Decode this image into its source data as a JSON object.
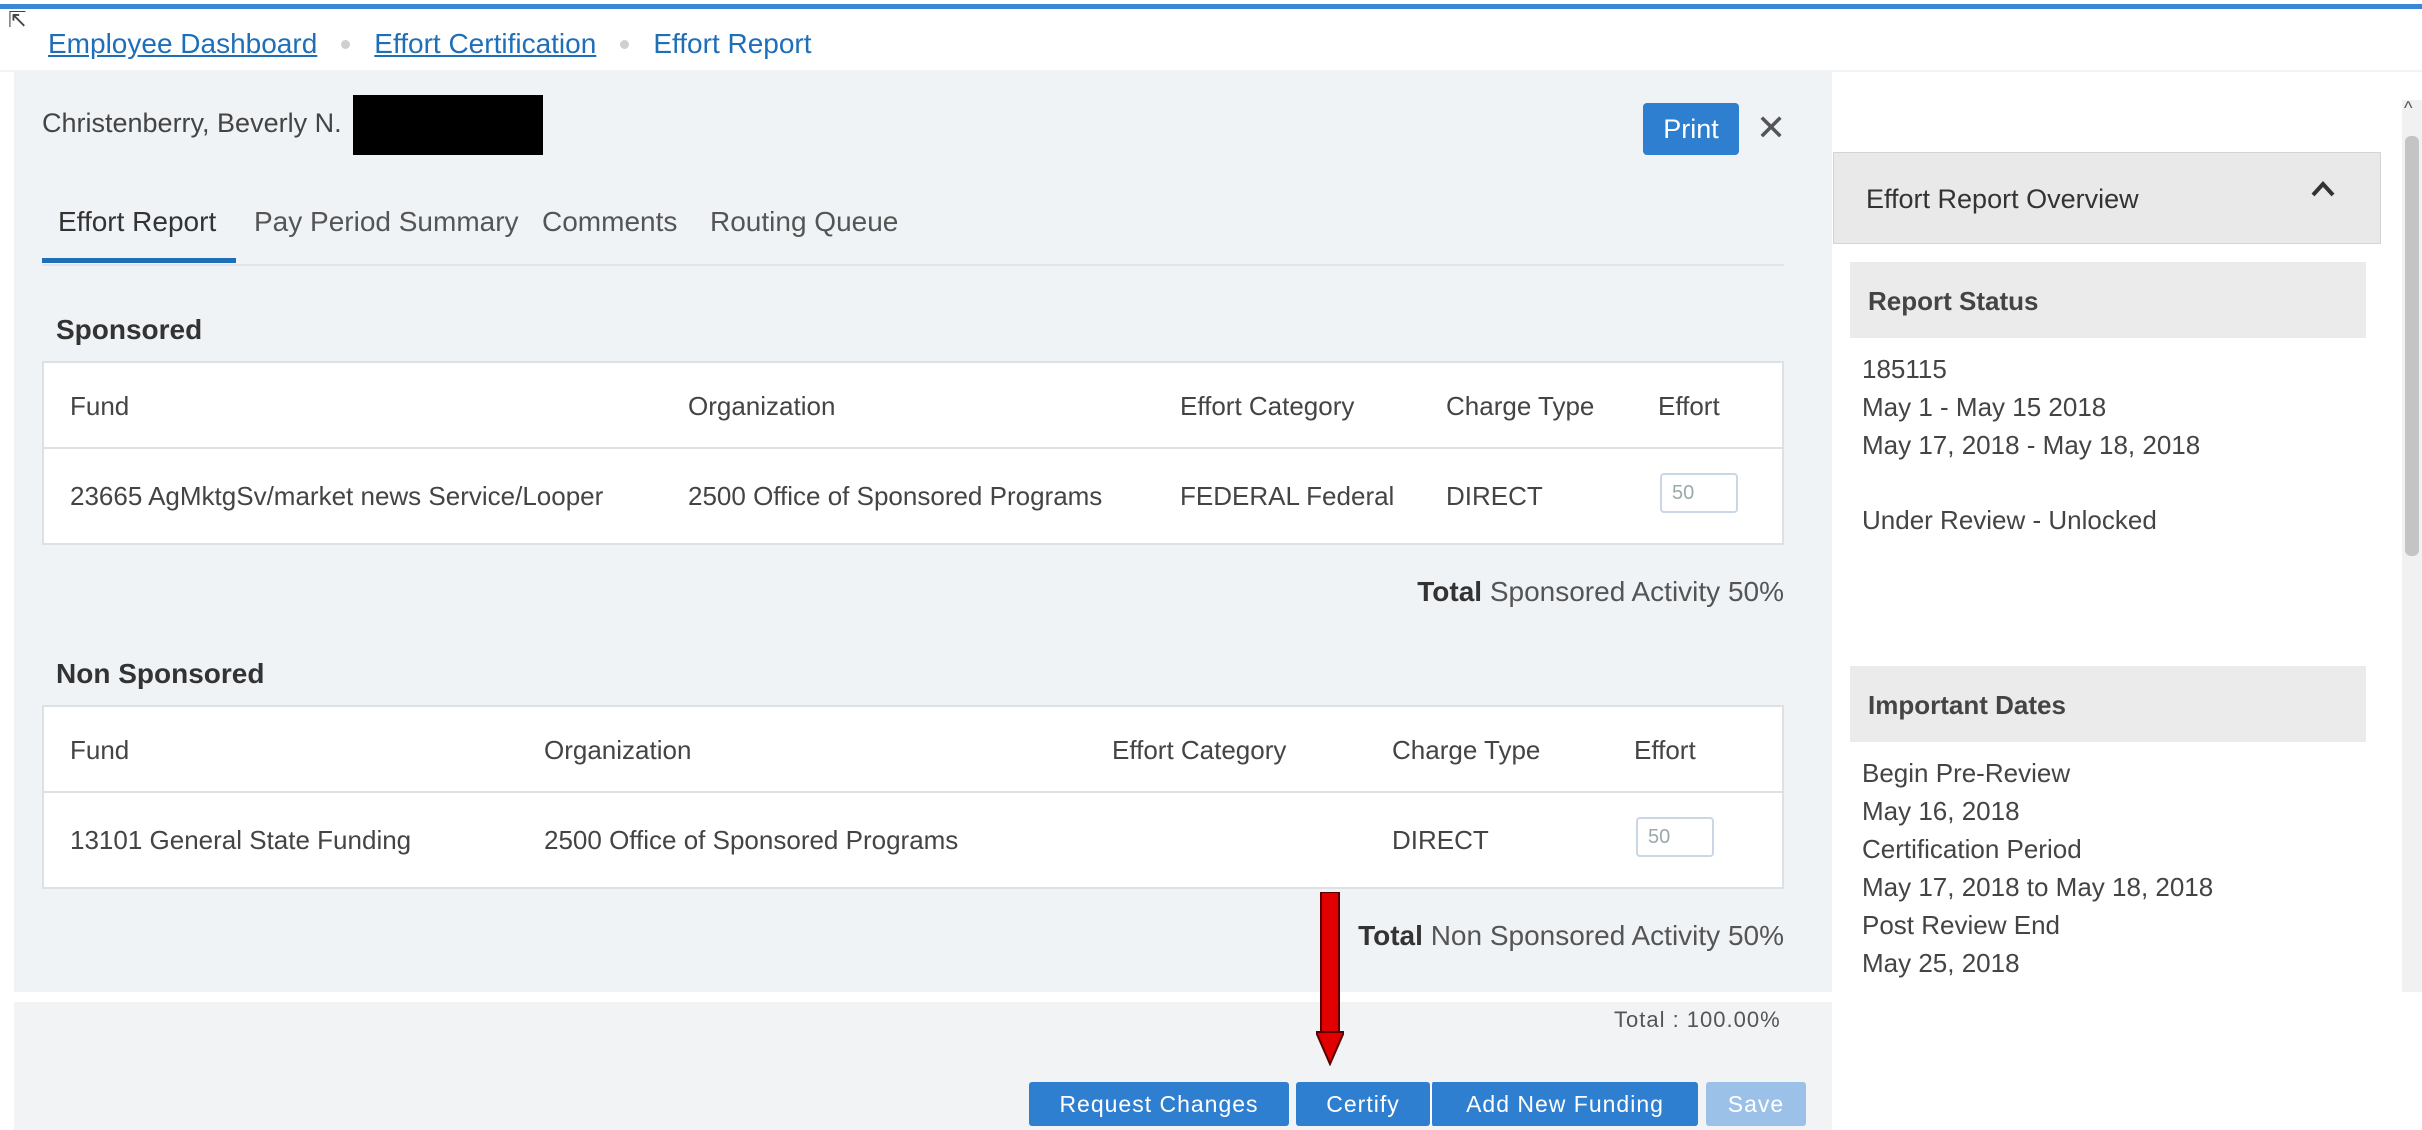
{
  "breadcrumb": {
    "items": [
      "Employee Dashboard",
      "Effort Certification"
    ],
    "current": "Effort Report"
  },
  "employee": {
    "name": "Christenberry, Beverly N."
  },
  "header": {
    "print_label": "Print",
    "close_icon": "close-icon"
  },
  "tabs": [
    {
      "label": "Effort Report",
      "active": true
    },
    {
      "label": "Pay Period Summary",
      "active": false
    },
    {
      "label": "Comments",
      "active": false
    },
    {
      "label": "Routing Queue",
      "active": false
    }
  ],
  "sponsored": {
    "title": "Sponsored",
    "columns": [
      "Fund",
      "Organization",
      "Effort Category",
      "Charge Type",
      "Effort"
    ],
    "rows": [
      {
        "fund": "23665 AgMktgSv/market news Service/Looper",
        "organization": "2500 Office of Sponsored Programs",
        "effort_category": "FEDERAL Federal",
        "charge_type": "DIRECT",
        "effort": "50"
      }
    ],
    "total_bold": "Total",
    "total_text": "Sponsored Activity 50%"
  },
  "non_sponsored": {
    "title": "Non Sponsored",
    "columns": [
      "Fund",
      "Organization",
      "Effort Category",
      "Charge Type",
      "Effort"
    ],
    "rows": [
      {
        "fund": "13101 General State Funding",
        "organization": "2500 Office of Sponsored Programs",
        "effort_category": "",
        "charge_type": "DIRECT",
        "effort": "50"
      }
    ],
    "total_bold": "Total",
    "total_text": "Non Sponsored Activity 50%"
  },
  "footer": {
    "grand_total": "Total : 100.00%",
    "buttons": {
      "request_changes": "Request Changes",
      "certify": "Certify",
      "add_funding": "Add New Funding",
      "save": "Save"
    }
  },
  "overview": {
    "title": "Effort Report Overview",
    "report_status": {
      "title": "Report Status",
      "id": "185115",
      "pay_period": "May 1 - May 15 2018",
      "date_range": "May 17, 2018 - May 18, 2018",
      "status": "Under Review - Unlocked"
    },
    "important_dates": {
      "title": "Important Dates",
      "lines": [
        "Begin Pre-Review",
        "May 16, 2018",
        "Certification Period",
        "May 17, 2018 to May 18, 2018",
        "Post Review End",
        "May 25, 2018"
      ]
    }
  },
  "colors": {
    "accent": "#2f7fd1",
    "link": "#1f6fb8",
    "arrow": "#e00000"
  }
}
